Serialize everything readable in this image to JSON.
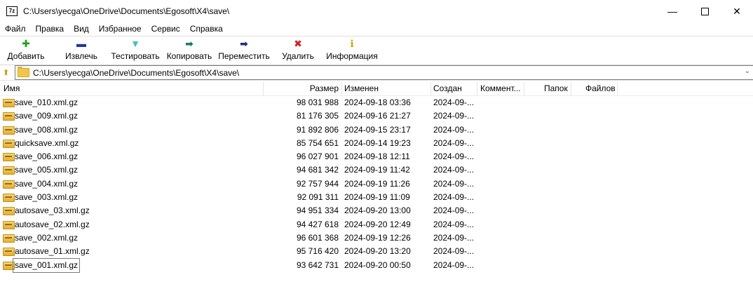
{
  "window": {
    "title": "C:\\Users\\yecga\\OneDrive\\Documents\\Egosoft\\X4\\save\\",
    "icon_text": "7z"
  },
  "menu": [
    "Файл",
    "Правка",
    "Вид",
    "Избранное",
    "Сервис",
    "Справка"
  ],
  "toolbar": [
    {
      "label": "Добавить",
      "icon": "plus-icon",
      "symbol": "✚",
      "color": "#1aa31a"
    },
    {
      "label": "Извлечь",
      "icon": "minus-icon",
      "symbol": "▬",
      "color": "#1f3a9c"
    },
    {
      "label": "Тестировать",
      "icon": "check-icon",
      "symbol": "▼",
      "color": "#3cc2c2"
    },
    {
      "label": "Копировать",
      "icon": "copy-arrow-icon",
      "symbol": "➡",
      "color": "#1a7a6a"
    },
    {
      "label": "Переместить",
      "icon": "move-arrow-icon",
      "symbol": "➡",
      "color": "#1f2a8a"
    },
    {
      "label": "Удалить",
      "icon": "delete-x-icon",
      "symbol": "✖",
      "color": "#d02020"
    },
    {
      "label": "Информация",
      "icon": "info-icon",
      "symbol": "ℹ",
      "color": "#c9a500"
    }
  ],
  "address": {
    "path": "C:\\Users\\yecga\\OneDrive\\Documents\\Egosoft\\X4\\save\\"
  },
  "columns": {
    "name": "Имя",
    "size": "Размер",
    "modified": "Изменен",
    "created": "Создан",
    "comment": "Коммент...",
    "folders": "Папок",
    "files": "Файлов"
  },
  "files": [
    {
      "name": "save_010.xml.gz",
      "size": "98 031 988",
      "modified": "2024-09-18 03:36",
      "created": "2024-09-..."
    },
    {
      "name": "save_009.xml.gz",
      "size": "81 176 305",
      "modified": "2024-09-16 21:27",
      "created": "2024-09-..."
    },
    {
      "name": "save_008.xml.gz",
      "size": "91 892 806",
      "modified": "2024-09-15 23:17",
      "created": "2024-09-..."
    },
    {
      "name": "quicksave.xml.gz",
      "size": "85 754 651",
      "modified": "2024-09-14 19:23",
      "created": "2024-09-..."
    },
    {
      "name": "save_006.xml.gz",
      "size": "96 027 901",
      "modified": "2024-09-18 12:11",
      "created": "2024-09-..."
    },
    {
      "name": "save_005.xml.gz",
      "size": "94 681 342",
      "modified": "2024-09-19 11:42",
      "created": "2024-09-..."
    },
    {
      "name": "save_004.xml.gz",
      "size": "92 757 944",
      "modified": "2024-09-19 11:26",
      "created": "2024-09-..."
    },
    {
      "name": "save_003.xml.gz",
      "size": "92 091 311",
      "modified": "2024-09-19 11:09",
      "created": "2024-09-..."
    },
    {
      "name": "autosave_03.xml.gz",
      "size": "94 951 334",
      "modified": "2024-09-20 13:00",
      "created": "2024-09-..."
    },
    {
      "name": "autosave_02.xml.gz",
      "size": "94 427 618",
      "modified": "2024-09-20 12:49",
      "created": "2024-09-..."
    },
    {
      "name": "save_002.xml.gz",
      "size": "96 601 368",
      "modified": "2024-09-19 12:26",
      "created": "2024-09-..."
    },
    {
      "name": "autosave_01.xml.gz",
      "size": "95 716 420",
      "modified": "2024-09-20 13:20",
      "created": "2024-09-..."
    },
    {
      "name": "save_001.xml.gz",
      "size": "93 642 731",
      "modified": "2024-09-20 00:50",
      "created": "2024-09-...",
      "selected": true
    }
  ]
}
